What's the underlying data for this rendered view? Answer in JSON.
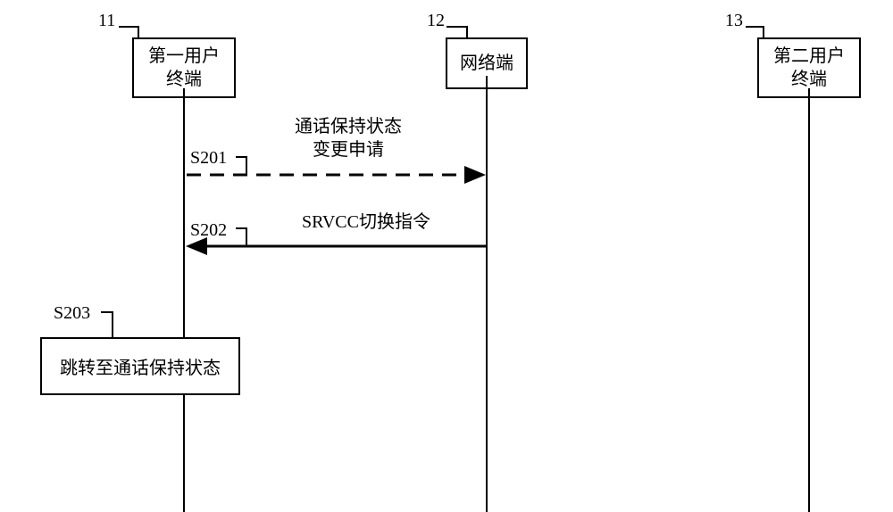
{
  "actors": {
    "a1": {
      "ref": "11",
      "label": "第一用户\n终端"
    },
    "a2": {
      "ref": "12",
      "label": "网络端"
    },
    "a3": {
      "ref": "13",
      "label": "第二用户\n终端"
    }
  },
  "messages": {
    "m1": {
      "step": "S201",
      "text": "通话保持状态\n变更申请"
    },
    "m2": {
      "step": "S202",
      "text": "SRVCC切换指令"
    }
  },
  "process": {
    "p1": {
      "step": "S203",
      "text": "跳转至通话保持状态"
    }
  }
}
